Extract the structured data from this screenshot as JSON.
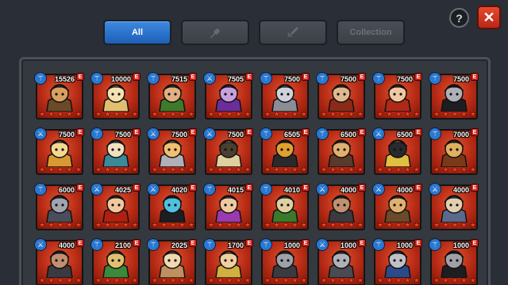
{
  "tabs": [
    {
      "label": "All",
      "active": true,
      "icon": null
    },
    {
      "label": "",
      "active": false,
      "icon": "hand-icon"
    },
    {
      "label": "",
      "active": false,
      "icon": "sword-icon"
    },
    {
      "label": "Collection",
      "active": false,
      "icon": null
    }
  ],
  "help_label": "?",
  "close_label": "✕",
  "colors": {
    "accent_tab": "#2a74d0",
    "card_bg": "#c63a1f",
    "grade": "#d3231a"
  },
  "heroes": [
    {
      "power": "15526",
      "grade": "E",
      "class_icon": "staff-icon",
      "stars": 5,
      "palette": [
        "#6b4a2a",
        "#d8a060"
      ]
    },
    {
      "power": "10000",
      "grade": "E",
      "class_icon": "staff-icon",
      "stars": 5,
      "palette": [
        "#e0c070",
        "#f4e2b0"
      ]
    },
    {
      "power": "7515",
      "grade": "E",
      "class_icon": "staff-icon",
      "stars": 5,
      "palette": [
        "#3d7a2a",
        "#e0b080"
      ]
    },
    {
      "power": "7505",
      "grade": "E",
      "class_icon": "sword-icon",
      "stars": 5,
      "palette": [
        "#6a2e9a",
        "#c8a0e0"
      ]
    },
    {
      "power": "7500",
      "grade": "E",
      "class_icon": "staff-icon",
      "stars": 5,
      "palette": [
        "#8a8e96",
        "#d0d4da"
      ]
    },
    {
      "power": "7500",
      "grade": "E",
      "class_icon": "staff-icon",
      "stars": 5,
      "palette": [
        "#8a2a18",
        "#e0b890"
      ]
    },
    {
      "power": "7500",
      "grade": "E",
      "class_icon": "staff-icon",
      "stars": 5,
      "palette": [
        "#b02818",
        "#f0c8a0"
      ]
    },
    {
      "power": "7500",
      "grade": "E",
      "class_icon": "staff-icon",
      "stars": 5,
      "palette": [
        "#1e1e22",
        "#b0b0b8"
      ]
    },
    {
      "power": "7500",
      "grade": "E",
      "class_icon": "sword-icon",
      "stars": 5,
      "palette": [
        "#d89a30",
        "#f4d890"
      ]
    },
    {
      "power": "7500",
      "grade": "E",
      "class_icon": "staff-icon",
      "stars": 5,
      "palette": [
        "#3a8a9a",
        "#f0e0c0"
      ]
    },
    {
      "power": "7500",
      "grade": "E",
      "class_icon": "sword-icon",
      "stars": 5,
      "palette": [
        "#b0b0b8",
        "#f0c070"
      ]
    },
    {
      "power": "7500",
      "grade": "E",
      "class_icon": "sword-icon",
      "stars": 5,
      "palette": [
        "#e0d0a0",
        "#4a4030"
      ]
    },
    {
      "power": "6505",
      "grade": "E",
      "class_icon": "staff-icon",
      "stars": 5,
      "palette": [
        "#2a2a2e",
        "#e0a030"
      ]
    },
    {
      "power": "6500",
      "grade": "E",
      "class_icon": "staff-icon",
      "stars": 5,
      "palette": [
        "#5a3a2a",
        "#e0b070"
      ]
    },
    {
      "power": "6500",
      "grade": "E",
      "class_icon": "sword-icon",
      "stars": 5,
      "palette": [
        "#e0c040",
        "#2a2a2e"
      ]
    },
    {
      "power": "7000",
      "grade": "E",
      "class_icon": "staff-icon",
      "stars": 5,
      "palette": [
        "#7a3a18",
        "#e0b060"
      ]
    },
    {
      "power": "6000",
      "grade": "E",
      "class_icon": "staff-icon",
      "stars": 5,
      "palette": [
        "#4a4e5a",
        "#a0a4ae"
      ]
    },
    {
      "power": "4025",
      "grade": "E",
      "class_icon": "sword-icon",
      "stars": 5,
      "palette": [
        "#b02010",
        "#f0c8a0"
      ]
    },
    {
      "power": "4020",
      "grade": "E",
      "class_icon": "sword-icon",
      "stars": 5,
      "palette": [
        "#1e1e22",
        "#50c0e0"
      ]
    },
    {
      "power": "4015",
      "grade": "E",
      "class_icon": "staff-icon",
      "stars": 5,
      "palette": [
        "#9a3ab0",
        "#f0c8a0"
      ]
    },
    {
      "power": "4010",
      "grade": "E",
      "class_icon": "staff-icon",
      "stars": 5,
      "palette": [
        "#3a7a2a",
        "#e0d0a0"
      ]
    },
    {
      "power": "4000",
      "grade": "E",
      "class_icon": "sword-icon",
      "stars": 5,
      "palette": [
        "#3a3a40",
        "#c09070"
      ]
    },
    {
      "power": "4000",
      "grade": "E",
      "class_icon": "sword-icon",
      "stars": 5,
      "palette": [
        "#6a4a2a",
        "#e0b070"
      ]
    },
    {
      "power": "4000",
      "grade": "E",
      "class_icon": "sword-icon",
      "stars": 5,
      "palette": [
        "#5a6a8a",
        "#e0d0b0"
      ]
    },
    {
      "power": "4000",
      "grade": "E",
      "class_icon": "sword-icon",
      "stars": 5,
      "palette": [
        "#3a3a40",
        "#c09070"
      ]
    },
    {
      "power": "2100",
      "grade": "E",
      "class_icon": "staff-icon",
      "stars": 5,
      "palette": [
        "#3a8a3a",
        "#e0c070"
      ]
    },
    {
      "power": "2025",
      "grade": "E",
      "class_icon": "staff-icon",
      "stars": 5,
      "palette": [
        "#c09060",
        "#f0d8b0"
      ]
    },
    {
      "power": "1700",
      "grade": "E",
      "class_icon": "staff-icon",
      "stars": 5,
      "palette": [
        "#d0b040",
        "#f0d0a0"
      ]
    },
    {
      "power": "1000",
      "grade": "E",
      "class_icon": "staff-icon",
      "stars": 5,
      "palette": [
        "#3a3a40",
        "#a0a0a8"
      ]
    },
    {
      "power": "1000",
      "grade": "E",
      "class_icon": "sword-icon",
      "stars": 5,
      "palette": [
        "#4a4a52",
        "#b0b0b8"
      ]
    },
    {
      "power": "1000",
      "grade": "E",
      "class_icon": "staff-icon",
      "stars": 5,
      "palette": [
        "#2a4a8a",
        "#c0c0c8"
      ]
    },
    {
      "power": "1000",
      "grade": "E",
      "class_icon": "staff-icon",
      "stars": 5,
      "palette": [
        "#1e1e22",
        "#a0a0a8"
      ]
    }
  ]
}
